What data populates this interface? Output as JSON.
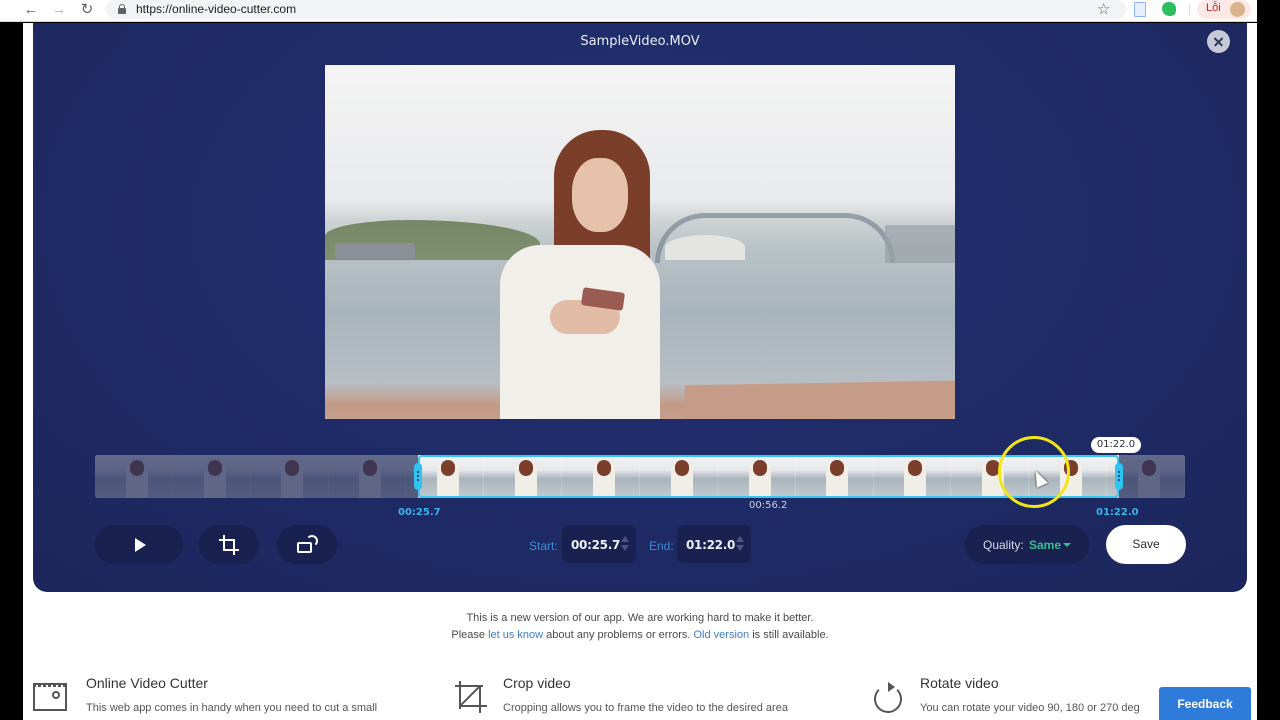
{
  "browser": {
    "url": "https://online-video-cutter.com",
    "back_icon": "arrow-left-icon",
    "forward_icon": "arrow-right-icon",
    "reload_icon": "reload-icon",
    "profile_label": "Lỗi"
  },
  "editor": {
    "file_name": "SampleVideo.MOV",
    "timeline": {
      "start_label": "00:25.7",
      "mid_label": "00:56.2",
      "end_label": "01:22.0",
      "tooltip": "01:22.0",
      "selection_start_fraction": 0.296,
      "selection_end_fraction": 0.939,
      "thumbnail_count": 14
    },
    "controls": {
      "start_label": "Start:",
      "start_value": "00:25.7",
      "end_label": "End:",
      "end_value": "01:22.0",
      "quality_label": "Quality:",
      "quality_value": "Same",
      "save_label": "Save"
    }
  },
  "notice": {
    "line1": "This is a new version of our app. We are working hard to make it better.",
    "line2_pre": "Please ",
    "line2_link1": "let us know",
    "line2_mid": " about any problems or errors. ",
    "line2_link2": "Old version",
    "line2_post": " is still available."
  },
  "features": [
    {
      "title": "Online Video Cutter",
      "desc": "This web app comes in handy when you need to cut a small",
      "icon": "film-scissors-icon"
    },
    {
      "title": "Crop video",
      "desc": "Cropping allows you to frame the video to the desired area",
      "icon": "crop-icon"
    },
    {
      "title": "Rotate video",
      "desc": "You can rotate your video 90, 180 or 270 deg",
      "icon": "rotate-icon"
    }
  ],
  "feedback_label": "Feedback",
  "colors": {
    "editor_bg": "#1f2b66",
    "accent_cyan": "#2fc3ef",
    "quality_green": "#34c08f",
    "feedback_blue": "#2f7bd9",
    "cursor_highlight": "#f2e619"
  }
}
